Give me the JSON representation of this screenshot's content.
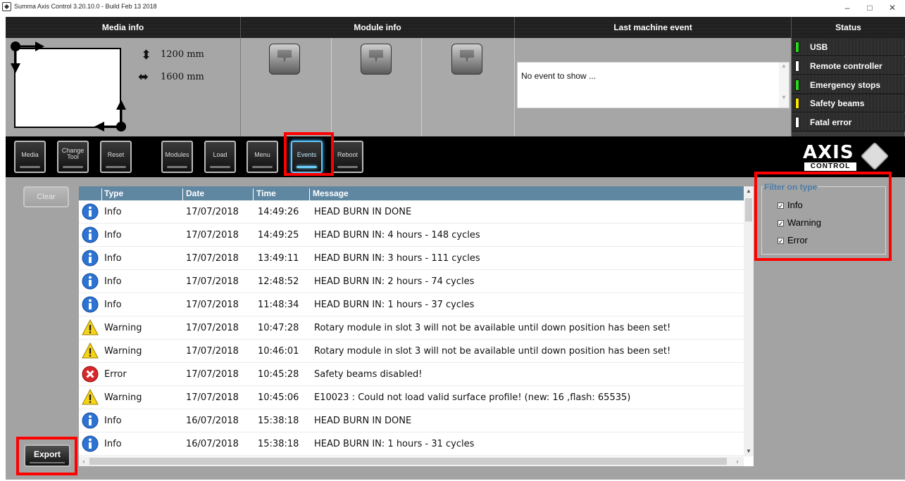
{
  "window": {
    "title": "Summa Axis Control 3.20.10.0 - Build Feb 13 2018",
    "min": "–",
    "max": "□",
    "close": "✕"
  },
  "header": {
    "media": "Media info",
    "module": "Module info",
    "event": "Last machine event",
    "status": "Status"
  },
  "media": {
    "height": "1200 mm",
    "width": "1600 mm"
  },
  "last_event": {
    "text": "No event to show ..."
  },
  "status": [
    {
      "label": "USB",
      "led": "#29d81c"
    },
    {
      "label": "Remote controller",
      "led": "#ffffff"
    },
    {
      "label": "Emergency stops",
      "led": "#29d81c"
    },
    {
      "label": "Safety beams",
      "led": "#ffe600"
    },
    {
      "label": "Fatal error",
      "led": "#ffffff"
    }
  ],
  "toolbar": {
    "media": "Media",
    "change_tool": "Change\nTool",
    "reset": "Reset",
    "modules": "Modules",
    "load": "Load",
    "menu": "Menu",
    "events": "Events",
    "reboot": "Reboot",
    "active": "Events"
  },
  "logo": {
    "name": "AXIS",
    "sub": "CONTROL"
  },
  "actions": {
    "clear": "Clear",
    "export": "Export"
  },
  "table": {
    "columns": [
      "Type",
      "Date",
      "Time",
      "Message"
    ],
    "rows": [
      {
        "type": "Info",
        "date": "17/07/2018",
        "time": "14:49:26",
        "message": "HEAD BURN IN DONE",
        "icon": "info-icon"
      },
      {
        "type": "Info",
        "date": "17/07/2018",
        "time": "14:49:25",
        "message": "HEAD BURN IN: 4 hours - 148 cycles",
        "icon": "info-icon"
      },
      {
        "type": "Info",
        "date": "17/07/2018",
        "time": "13:49:11",
        "message": "HEAD BURN IN: 3 hours - 111 cycles",
        "icon": "info-icon"
      },
      {
        "type": "Info",
        "date": "17/07/2018",
        "time": "12:48:52",
        "message": "HEAD BURN IN: 2 hours - 74 cycles",
        "icon": "info-icon"
      },
      {
        "type": "Info",
        "date": "17/07/2018",
        "time": "11:48:34",
        "message": "HEAD BURN IN: 1 hours - 37 cycles",
        "icon": "info-icon"
      },
      {
        "type": "Warning",
        "date": "17/07/2018",
        "time": "10:47:28",
        "message": "Rotary module in slot 3 will not be available until down position has been set!",
        "icon": "warning-icon"
      },
      {
        "type": "Warning",
        "date": "17/07/2018",
        "time": "10:46:01",
        "message": "Rotary module in slot 3 will not be available until down position has been set!",
        "icon": "warning-icon"
      },
      {
        "type": "Error",
        "date": "17/07/2018",
        "time": "10:45:28",
        "message": "Safety beams disabled!",
        "icon": "error-icon"
      },
      {
        "type": "Warning",
        "date": "17/07/2018",
        "time": "10:45:06",
        "message": "E10023 : Could not load valid surface profile! (new: 16 ,flash: 65535)",
        "icon": "warning-icon"
      },
      {
        "type": "Info",
        "date": "16/07/2018",
        "time": "15:38:18",
        "message": "HEAD BURN IN DONE",
        "icon": "info-icon"
      },
      {
        "type": "Info",
        "date": "16/07/2018",
        "time": "15:38:18",
        "message": "HEAD BURN IN: 1 hours - 31 cycles",
        "icon": "info-icon"
      }
    ]
  },
  "filter": {
    "title": "Filter on type",
    "options": [
      {
        "label": "Info",
        "checked": true
      },
      {
        "label": "Warning",
        "checked": true
      },
      {
        "label": "Error",
        "checked": true
      }
    ]
  },
  "colors": {
    "highlight": "#ff0000",
    "table_header": "#5f87a2",
    "filter_title": "#4d7ea8",
    "active_glow": "#5ec7ff"
  }
}
